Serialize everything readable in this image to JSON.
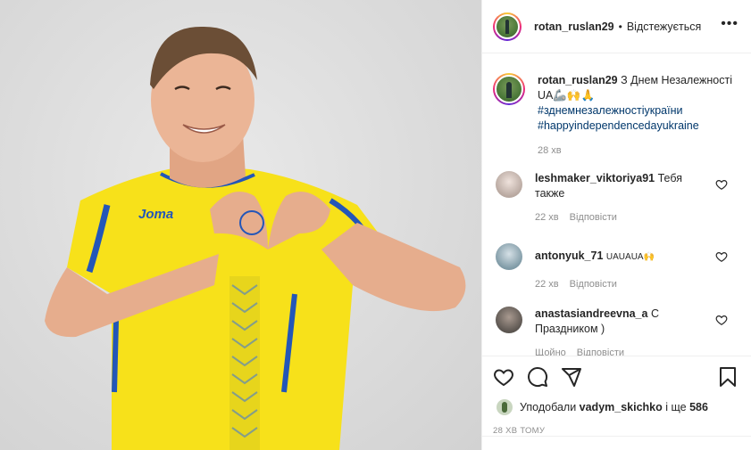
{
  "header": {
    "username": "rotan_ruslan29",
    "separator": "•",
    "follow_status": "Відстежується",
    "more_icon": "more-horizontal-icon"
  },
  "caption": {
    "username": "rotan_ruslan29",
    "text": "З Днем Незалежності UA🦾🙌🙏",
    "hashtags": [
      "#зднемнезалежностіукраїни",
      "#happyindependencedayukraine"
    ],
    "time": "28 хв"
  },
  "comments": [
    {
      "username": "leshmaker_viktoriya91",
      "text": "Тебя также",
      "time": "22 хв",
      "reply": "Відповісти",
      "avatar_color": "#b8a8a0"
    },
    {
      "username": "antonyuk_71",
      "text": "UAUAUA🙌",
      "time": "22 хв",
      "reply": "Відповісти",
      "avatar_color": "#7f9aa6"
    },
    {
      "username": "anastasiandreevna_a",
      "text": "С Праздником )",
      "time": "Щойно",
      "reply": "Відповісти",
      "avatar_color": "#5b5550"
    }
  ],
  "actions": {
    "icons": [
      "heart-icon",
      "comment-icon",
      "share-icon",
      "bookmark-icon"
    ]
  },
  "likes": {
    "prefix": "Уподобали",
    "user": "vadym_skichko",
    "middle": "і ще",
    "count": "586"
  },
  "posted_ago": "28 ХВ ТОМУ",
  "colors": {
    "shirt_yellow": "#f7e11a",
    "shirt_blue": "#2356b8",
    "background_gray": "#dddddd",
    "link_blue": "#00376b"
  },
  "photo": {
    "brand": "Joma"
  }
}
